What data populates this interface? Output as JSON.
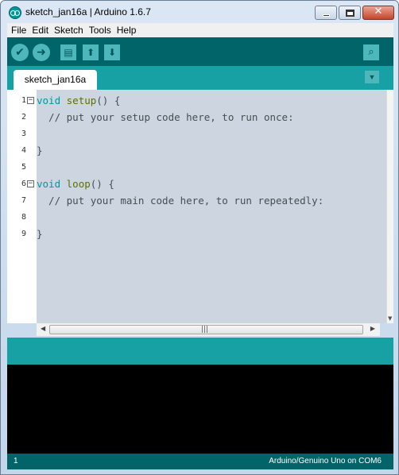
{
  "window": {
    "title": "sketch_jan16a | Arduino 1.6.7",
    "close_glyph": "✕"
  },
  "menu": [
    "File",
    "Edit",
    "Sketch",
    "Tools",
    "Help"
  ],
  "toolbar": {
    "verify_icon": "check-icon",
    "upload_icon": "arrow-right-icon",
    "new_icon": "file-icon",
    "open_icon": "upload-arrow-icon",
    "save_icon": "download-arrow-icon",
    "serial_monitor_icon": "magnifier-icon"
  },
  "tabs": [
    {
      "label": "sketch_jan16a"
    }
  ],
  "editor": {
    "lines": [
      {
        "num": "1",
        "fold": true
      },
      {
        "num": "2",
        "fold": false
      },
      {
        "num": "3",
        "fold": false
      },
      {
        "num": "4",
        "fold": false
      },
      {
        "num": "5",
        "fold": false
      },
      {
        "num": "6",
        "fold": true
      },
      {
        "num": "7",
        "fold": false
      },
      {
        "num": "8",
        "fold": false
      },
      {
        "num": "9",
        "fold": false
      }
    ],
    "code": {
      "l1_type": "void",
      "l1_func": "setup",
      "l1_rest": "() {",
      "l2": "  // put your setup code here, to run once:",
      "l4": "}",
      "l6_type": "void",
      "l6_func": "loop",
      "l6_rest": "() {",
      "l7": "  // put your main code here, to run repeatedly:",
      "l9": "}"
    }
  },
  "status": {
    "line": "1",
    "board": "Arduino/Genuino Uno on COM6"
  },
  "colors": {
    "toolbar": "#006468",
    "tabstrip": "#17a1a5",
    "editor_bg": "#cdd6e0",
    "keyword_type": "#00979c",
    "keyword_func": "#5e6d03",
    "console_bg": "#000000"
  }
}
